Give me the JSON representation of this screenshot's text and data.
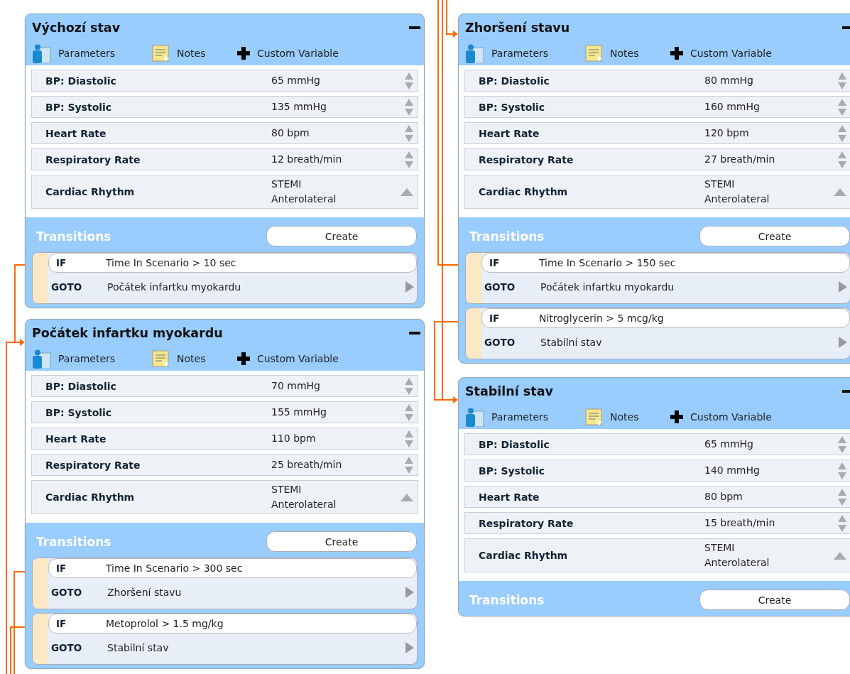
{
  "columns": [
    {
      "states": [
        {
          "title": "Výchozí stav",
          "toolbar": [
            "Parameters",
            "Notes",
            "Custom Variable"
          ],
          "parameters": [
            {
              "name": "BP: Diastolic",
              "value": "65 mmHg",
              "kind": "spinner"
            },
            {
              "name": "BP: Systolic",
              "value": "135 mmHg",
              "kind": "spinner"
            },
            {
              "name": "Heart Rate",
              "value": "80 bpm",
              "kind": "spinner"
            },
            {
              "name": "Respiratory Rate",
              "value": "12 breath/min",
              "kind": "spinner"
            },
            {
              "name": "Cardiac Rhythm",
              "value": "STEMI Anterolateral",
              "kind": "dropdown"
            }
          ],
          "transitions_label": "Transitions",
          "create_button": "Create",
          "transitions": [
            {
              "if_label": "IF",
              "condition": "Time In Scenario > 10 sec",
              "goto_label": "GOTO",
              "target": "Počátek infartku myokardu"
            }
          ]
        },
        {
          "title": "Počátek infartku myokardu",
          "toolbar": [
            "Parameters",
            "Notes",
            "Custom Variable"
          ],
          "parameters": [
            {
              "name": "BP: Diastolic",
              "value": "70 mmHg",
              "kind": "spinner"
            },
            {
              "name": "BP: Systolic",
              "value": "155 mmHg",
              "kind": "spinner"
            },
            {
              "name": "Heart Rate",
              "value": "110 bpm",
              "kind": "spinner"
            },
            {
              "name": "Respiratory Rate",
              "value": "25 breath/min",
              "kind": "spinner"
            },
            {
              "name": "Cardiac Rhythm",
              "value": "STEMI Anterolateral",
              "kind": "dropdown"
            }
          ],
          "transitions_label": "Transitions",
          "create_button": "Create",
          "transitions": [
            {
              "if_label": "IF",
              "condition": "Time In Scenario > 300 sec",
              "goto_label": "GOTO",
              "target": "Zhoršení stavu"
            },
            {
              "if_label": "IF",
              "condition": "Metoprolol > 1.5 mg/kg",
              "goto_label": "GOTO",
              "target": "Stabilní stav"
            }
          ]
        }
      ]
    },
    {
      "states": [
        {
          "title": "Zhoršení stavu",
          "toolbar": [
            "Parameters",
            "Notes",
            "Custom Variable"
          ],
          "parameters": [
            {
              "name": "BP: Diastolic",
              "value": "80 mmHg",
              "kind": "spinner"
            },
            {
              "name": "BP: Systolic",
              "value": "160 mmHg",
              "kind": "spinner"
            },
            {
              "name": "Heart Rate",
              "value": "120 bpm",
              "kind": "spinner"
            },
            {
              "name": "Respiratory Rate",
              "value": "27 breath/min",
              "kind": "spinner"
            },
            {
              "name": "Cardiac Rhythm",
              "value": "STEMI Anterolateral",
              "kind": "dropdown"
            }
          ],
          "transitions_label": "Transitions",
          "create_button": "Create",
          "transitions": [
            {
              "if_label": "IF",
              "condition": "Time In Scenario > 150 sec",
              "goto_label": "GOTO",
              "target": "Počátek infartku myokardu"
            },
            {
              "if_label": "IF",
              "condition": "Nitroglycerin > 5 mcg/kg",
              "goto_label": "GOTO",
              "target": "Stabilní stav"
            }
          ]
        },
        {
          "title": "Stabilní stav",
          "toolbar": [
            "Parameters",
            "Notes",
            "Custom Variable"
          ],
          "parameters": [
            {
              "name": "BP: Diastolic",
              "value": "65 mmHg",
              "kind": "spinner"
            },
            {
              "name": "BP: Systolic",
              "value": "140 mmHg",
              "kind": "spinner"
            },
            {
              "name": "Heart Rate",
              "value": "80 bpm",
              "kind": "spinner"
            },
            {
              "name": "Respiratory Rate",
              "value": "15 breath/min",
              "kind": "spinner"
            },
            {
              "name": "Cardiac Rhythm",
              "value": "STEMI Anterolateral",
              "kind": "dropdown"
            }
          ],
          "transitions_label": "Transitions",
          "create_button": "Create"
        }
      ]
    }
  ]
}
